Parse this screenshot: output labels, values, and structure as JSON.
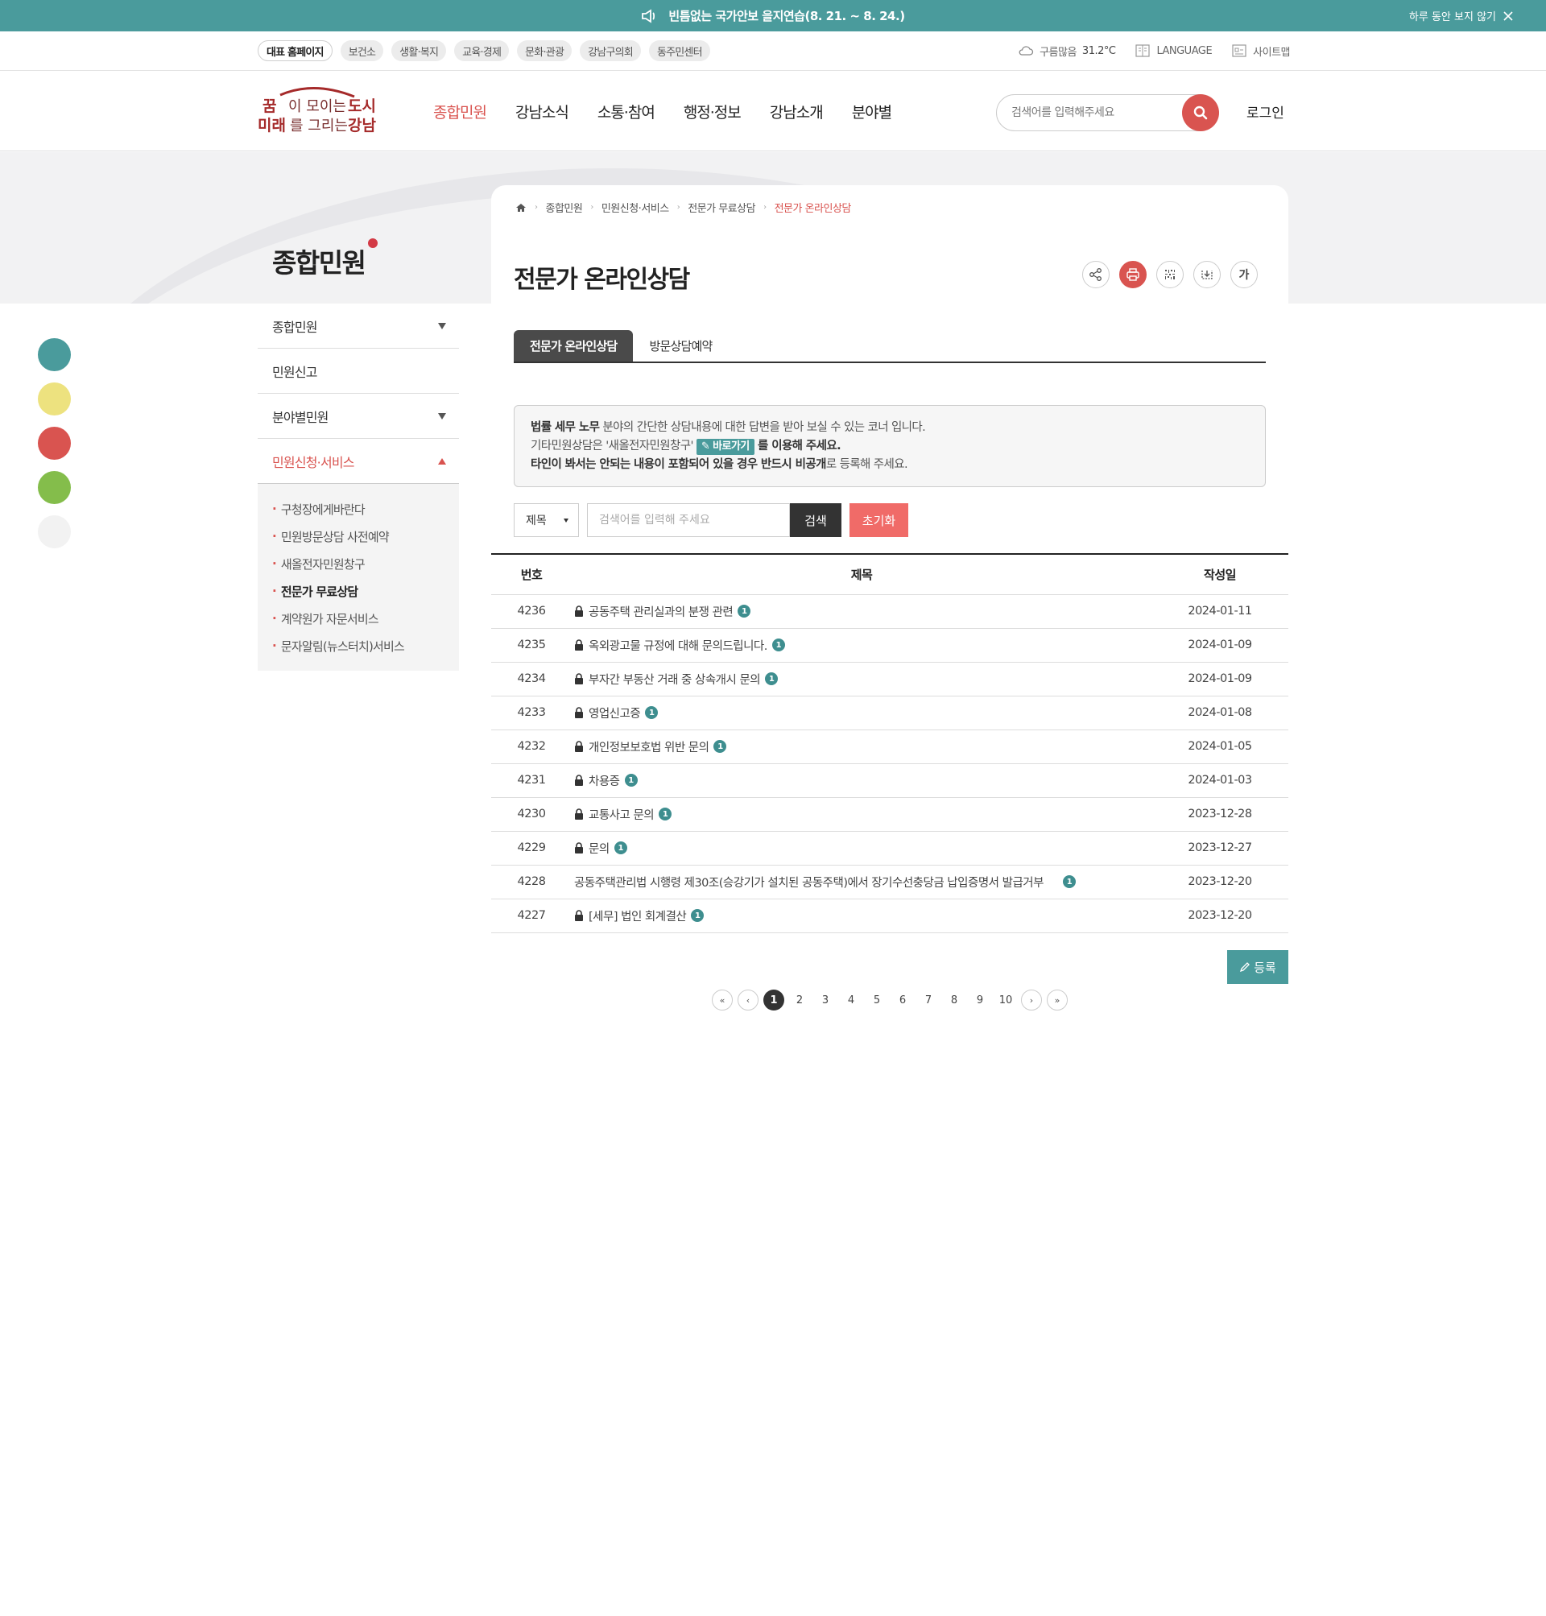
{
  "notice": {
    "message": "빈틈없는 국가안보 을지연습(8. 21. ~ 8. 24.)",
    "close_label": "하루 동안 보지 않기"
  },
  "sites": [
    "대표 홈페이지",
    "보건소",
    "생활·복지",
    "교육·경제",
    "문화·관광",
    "강남구의회",
    "동주민센터"
  ],
  "util": {
    "weather": "구름많음",
    "temperature": "31.2°C",
    "language": "LANGUAGE",
    "sitemap": "사이트맵"
  },
  "logo": {
    "line1_a": "꿈",
    "line1_b": "이 모이는 ",
    "line1_c": "도시",
    "line2_a": "미래",
    "line2_b": "를 그리는 ",
    "line2_c": "강남"
  },
  "gnb": [
    "종합민원",
    "강남소식",
    "소통·참여",
    "행정·정보",
    "강남소개",
    "분야별"
  ],
  "search": {
    "placeholder": "검색어를 입력해주세요"
  },
  "login": "로그인",
  "category_title": "종합민원",
  "lnb": {
    "items": [
      "종합민원",
      "민원신고",
      "분야별민원",
      "민원신청·서비스"
    ],
    "sub": [
      "구청장에게바란다",
      "민원방문상담 사전예약",
      "새올전자민원창구",
      "전문가 무료상담",
      "계약원가 자문서비스",
      "문자알림(뉴스터치)서비스"
    ]
  },
  "breadcrumb": [
    "종합민원",
    "민원신청·서비스",
    "전문가 무료상담",
    "전문가 온라인상담"
  ],
  "page_title": "전문가 온라인상담",
  "font_tool": "가",
  "tabs": [
    "전문가 온라인상담",
    "방문상담예약"
  ],
  "info": {
    "line1_bold": "법률 세무 노무",
    "line1_rest": " 분야의 간단한 상담내용에 대한 답변을 받아 보실 수 있는 코너 입니다.",
    "line2_pre": "기타민원상담은 '새올전자민원창구' ",
    "line2_btn": "바로가기",
    "line2_post": " 를 이용해 주세요.",
    "line3_bold": "타인이 봐서는 안되는 내용이 포함되어 있을 경우 반드시 비공개",
    "line3_rest": "로 등록해 주세요."
  },
  "filter": {
    "select_value": "제목",
    "placeholder": "검색어를 입력해 주세요",
    "search_btn": "검색",
    "reset_btn": "초기화"
  },
  "table": {
    "headers": [
      "번호",
      "제목",
      "작성일"
    ],
    "rows": [
      {
        "no": "4236",
        "title": "공동주택 관리실과의 분쟁 관련",
        "replies": "1",
        "date": "2024-01-11",
        "locked": true
      },
      {
        "no": "4235",
        "title": "옥외광고물 규정에 대해 문의드립니다.",
        "replies": "1",
        "date": "2024-01-09",
        "locked": true
      },
      {
        "no": "4234",
        "title": "부자간 부동산 거래 중 상속개시 문의",
        "replies": "1",
        "date": "2024-01-09",
        "locked": true
      },
      {
        "no": "4233",
        "title": "영업신고증",
        "replies": "1",
        "date": "2024-01-08",
        "locked": true
      },
      {
        "no": "4232",
        "title": "개인정보보호법 위반 문의",
        "replies": "1",
        "date": "2024-01-05",
        "locked": true
      },
      {
        "no": "4231",
        "title": "차용증",
        "replies": "1",
        "date": "2024-01-03",
        "locked": true
      },
      {
        "no": "4230",
        "title": "교통사고 문의",
        "replies": "1",
        "date": "2023-12-28",
        "locked": true
      },
      {
        "no": "4229",
        "title": "문의",
        "replies": "1",
        "date": "2023-12-27",
        "locked": true
      },
      {
        "no": "4228",
        "title": "공동주택관리법 시행령 제30조(승강기가 설치된 공동주택)에서 장기수선충당금 납입증명서 발급거부",
        "replies": "1",
        "date": "2023-12-20",
        "locked": false
      },
      {
        "no": "4227",
        "title": "[세무] 법인 회계결산",
        "replies": "1",
        "date": "2023-12-20",
        "locked": true
      }
    ]
  },
  "write_btn": "등록",
  "paging": {
    "pages": [
      "1",
      "2",
      "3",
      "4",
      "5",
      "6",
      "7",
      "8",
      "9",
      "10"
    ],
    "current": "1"
  },
  "colors": {
    "accent": "#4a9b9c",
    "brand_red": "#d95450",
    "dot_colors": [
      "#4a9b9c",
      "#ede27f",
      "#d95450",
      "#84bd4b",
      "#f2f2f2"
    ]
  },
  "icons": {
    "notice": "megaphone-icon",
    "weather": "cloud-icon",
    "language": "book-icon",
    "sitemap": "sitemap-icon",
    "search": "search-icon",
    "home": "home-icon",
    "share": "share-icon",
    "print": "print-icon",
    "qr": "qr-icon",
    "download": "download-icon",
    "lock": "lock-icon",
    "write": "pencil-icon"
  }
}
